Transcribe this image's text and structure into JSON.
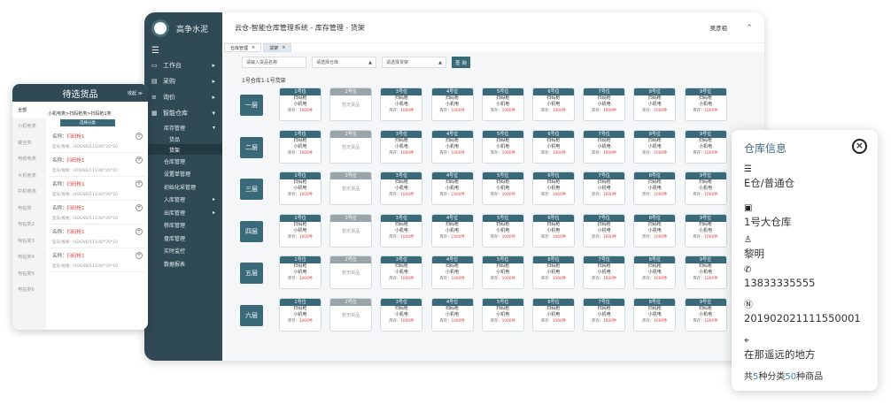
{
  "app": {
    "brand": "高争水泥",
    "header_title": "云仓-智能仓库管理系统  -  库存管理  -  货架",
    "user": "吴彦祖",
    "collapse": "^"
  },
  "sidebar": {
    "menu_toggle": "☰",
    "items": [
      {
        "label": "工作台",
        "icon": "▭",
        "arrow": "▸"
      },
      {
        "label": "采购",
        "icon": "▤",
        "arrow": "▸"
      },
      {
        "label": "询价",
        "icon": "≡",
        "arrow": "▸"
      },
      {
        "label": "智能仓库",
        "icon": "▦",
        "arrow": "▾"
      }
    ],
    "stock": {
      "label": "库存管理",
      "arrow": "▾"
    },
    "stock_sub": [
      "货品",
      "货架"
    ],
    "level1": [
      {
        "label": "仓库管理",
        "arrow": ""
      },
      {
        "label": "设置单管理",
        "arrow": ""
      },
      {
        "label": "初始化采管理",
        "arrow": ""
      },
      {
        "label": "入库管理",
        "arrow": "▸"
      },
      {
        "label": "出库管理",
        "arrow": "▸"
      },
      {
        "label": "移库管理",
        "arrow": ""
      },
      {
        "label": "盘库管理",
        "arrow": ""
      },
      {
        "label": "实时监控",
        "arrow": ""
      },
      {
        "label": "数据报表",
        "arrow": ""
      }
    ]
  },
  "tabs": [
    {
      "label": "仓库管理",
      "close": "×"
    },
    {
      "label": "货架",
      "close": "×"
    }
  ],
  "filters": {
    "name_placeholder": "请输入货品名称",
    "warehouse": "请选择仓库",
    "shelf": "请选择货架",
    "query": "查 询",
    "caret": "▲"
  },
  "rack_title": "1号仓库1-1号货架",
  "floors": [
    "一层",
    "二层",
    "三层",
    "四层",
    "五层",
    "六层"
  ],
  "cells": [
    {
      "pos": "1号位",
      "l1": "扫码枪",
      "l2": "小机电",
      "stock_label": "库存：",
      "qty": "1000件",
      "empty": false
    },
    {
      "pos": "2号位",
      "empty": true,
      "empty_text": "暂无货品"
    },
    {
      "pos": "3号位",
      "l1": "扫码枪",
      "l2": "小机电",
      "stock_label": "库存：",
      "qty": "1000件",
      "empty": false
    },
    {
      "pos": "4号位",
      "l1": "扫码枪",
      "l2": "小机电",
      "stock_label": "库存：",
      "qty": "1000件",
      "empty": false
    },
    {
      "pos": "5号位",
      "l1": "扫码枪",
      "l2": "小机电",
      "stock_label": "库存：",
      "qty": "1000件",
      "empty": false
    },
    {
      "pos": "6号位",
      "l1": "扫码枪",
      "l2": "小机电",
      "stock_label": "库存：",
      "qty": "1000件",
      "empty": false
    },
    {
      "pos": "7号位",
      "l1": "扫码枪",
      "l2": "小机电",
      "stock_label": "库存：",
      "qty": "1000件",
      "empty": false
    },
    {
      "pos": "8号位",
      "l1": "扫码枪",
      "l2": "小机电",
      "stock_label": "库存：",
      "qty": "1000件",
      "empty": false
    },
    {
      "pos": "9号位",
      "l1": "扫码枪",
      "l2": "小机电",
      "stock_label": "库存：",
      "qty": "1000件",
      "empty": false
    }
  ],
  "left_panel": {
    "title": "待选货品",
    "fold": "收起 ≫",
    "categories": [
      "全部",
      "小机电类",
      "螺丝类",
      "电缆电类",
      "大机电类",
      "中机电类",
      "电钻类",
      "电钻类2",
      "电钻类3",
      "电钻类4",
      "电钻类5",
      "电钻类6"
    ],
    "crumb": "小机电类>扫码枪类>扫码枪1类",
    "select_class": "选择分类",
    "goods": [
      {
        "name_label": "名称：",
        "name": "扫码枪1",
        "model": "型号/规格：HDGNS/111/40*20*10"
      },
      {
        "name_label": "名称：",
        "name": "扫码枪1",
        "model": "型号/规格：HDGNS/111/40*20*10"
      },
      {
        "name_label": "名称：",
        "name": "扫码枪1",
        "model": "型号/规格：HDGNS/111/40*20*10"
      },
      {
        "name_label": "名称：",
        "name": "扫码枪1",
        "model": "型号/规格：HDGNS/111/40*20*10"
      },
      {
        "name_label": "名称：",
        "name": "扫码枪1",
        "model": "型号/规格：HDGNS/111/40*20*10"
      },
      {
        "name_label": "名称：",
        "name": "扫码枪1",
        "model": "型号/规格：HDGNS/111/40*20*10"
      }
    ],
    "plus": "+"
  },
  "right_panel": {
    "title": "仓库信息",
    "close": "×",
    "items": [
      {
        "icon": "list-icon",
        "glyph": "☰",
        "text": "E仓/普通仓"
      },
      {
        "icon": "warehouse-icon",
        "glyph": "▣",
        "text": "1号大仓库"
      },
      {
        "icon": "person-icon",
        "glyph": "♙",
        "text": "黎明"
      },
      {
        "icon": "phone-icon",
        "glyph": "✆",
        "text": "13833335555"
      },
      {
        "icon": "number-icon",
        "glyph": "Ⓝ",
        "text": "201902021111550001"
      },
      {
        "icon": "location-icon",
        "glyph": "⌖",
        "text": "在那遥远的地方"
      }
    ],
    "summary_pre": "共",
    "summary_kinds": "5",
    "summary_mid": "种分类",
    "summary_goods": "50",
    "summary_post": "种商品"
  }
}
